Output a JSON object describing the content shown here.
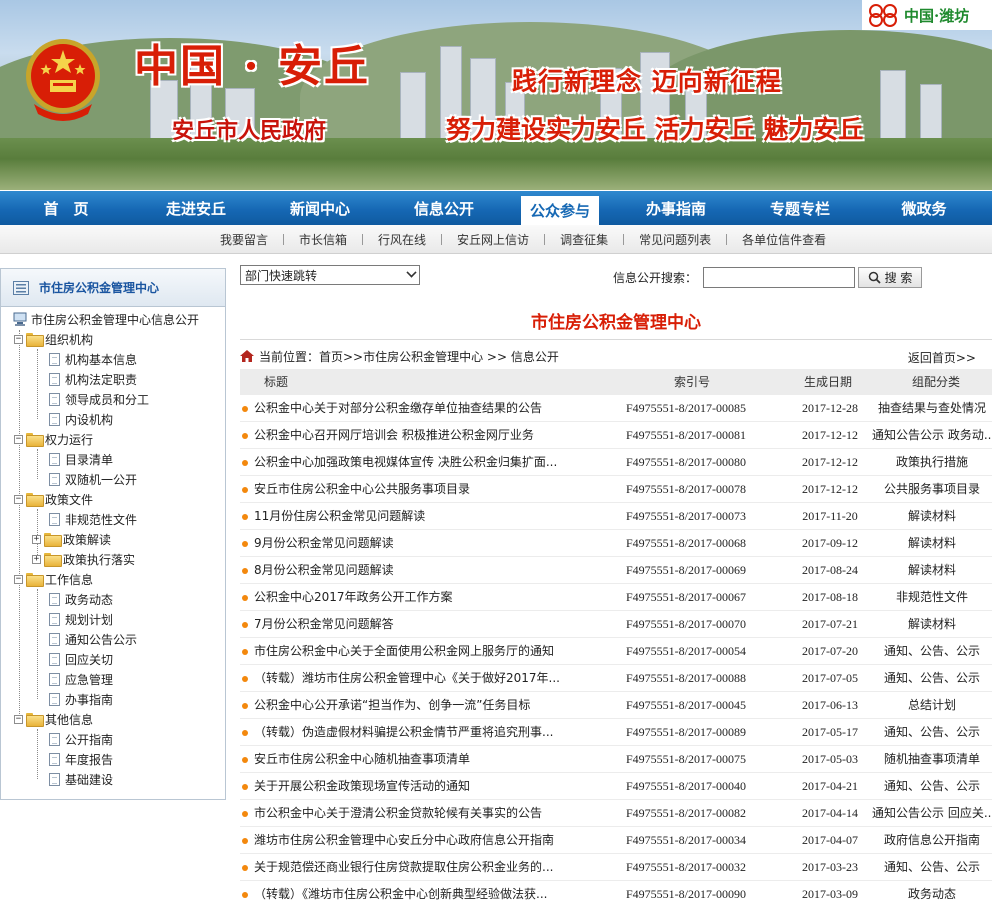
{
  "banner": {
    "site_title": "中国 · 安丘",
    "site_subtitle": "安丘市人民政府",
    "slogan_line1": "践行新理念   迈向新征程",
    "slogan_line2": "努力建设实力安丘  活力安丘  魅力安丘",
    "partner_link": "中国·潍坊"
  },
  "main_nav": {
    "items": [
      "首　页",
      "走进安丘",
      "新闻中心",
      "信息公开",
      "公众参与",
      "办事指南",
      "专题专栏",
      "微政务"
    ],
    "active": "公众参与",
    "colors": {
      "bar": "#1668b4",
      "active_bg": "#ffffff"
    }
  },
  "sub_nav": {
    "items": [
      "我要留言",
      "市长信箱",
      "行风在线",
      "安丘网上信访",
      "调查征集",
      "常见问题列表",
      "各单位信件查看"
    ]
  },
  "sidebar": {
    "title": "市住房公积金管理中心",
    "root": "市住房公积金管理中心信息公开",
    "groups": [
      {
        "label": "组织机构",
        "items": [
          "机构基本信息",
          "机构法定职责",
          "领导成员和分工",
          "内设机构"
        ]
      },
      {
        "label": "权力运行",
        "items": [
          "目录清单",
          "双随机一公开"
        ]
      },
      {
        "label": "政策文件",
        "items": [
          "非规范性文件",
          "政策解读",
          "政策执行落实"
        ]
      },
      {
        "label": "工作信息",
        "items": [
          "政务动态",
          "规划计划",
          "通知公告公示",
          "回应关切",
          "应急管理",
          "办事指南"
        ]
      },
      {
        "label": "其他信息",
        "items": [
          "公开指南",
          "年度报告",
          "基础建设"
        ]
      }
    ]
  },
  "toolbar": {
    "dept_select_value": "部门快速跳转",
    "search_label": "信息公开搜索：",
    "search_value": "",
    "search_button": "搜 索"
  },
  "content": {
    "page_title": "市住房公积金管理中心",
    "breadcrumb": "当前位置：首页>>市住房公积金管理中心 >> 信息公开",
    "back_link": "返回首页>>",
    "columns": [
      "标题",
      "索引号",
      "生成日期",
      "组配分类"
    ],
    "rows": [
      [
        "公积金中心关于对部分公积金缴存单位抽查结果的公告",
        "F4975551-8/2017-00085",
        "2017-12-28",
        "抽查结果与查处情况"
      ],
      [
        "公积金中心召开网厅培训会 积极推进公积金网厅业务",
        "F4975551-8/2017-00081",
        "2017-12-12",
        "通知公告公示 政务动..."
      ],
      [
        "公积金中心加强政策电视媒体宣传 决胜公积金归集扩面...",
        "F4975551-8/2017-00080",
        "2017-12-12",
        "政策执行措施"
      ],
      [
        "安丘市住房公积金中心公共服务事项目录",
        "F4975551-8/2017-00078",
        "2017-12-12",
        "公共服务事项目录"
      ],
      [
        "11月份住房公积金常见问题解读",
        "F4975551-8/2017-00073",
        "2017-11-20",
        "解读材料"
      ],
      [
        "9月份公积金常见问题解读",
        "F4975551-8/2017-00068",
        "2017-09-12",
        "解读材料"
      ],
      [
        "8月份公积金常见问题解读",
        "F4975551-8/2017-00069",
        "2017-08-24",
        "解读材料"
      ],
      [
        "公积金中心2017年政务公开工作方案",
        "F4975551-8/2017-00067",
        "2017-08-18",
        "非规范性文件"
      ],
      [
        "7月份公积金常见问题解答",
        "F4975551-8/2017-00070",
        "2017-07-21",
        "解读材料"
      ],
      [
        "市住房公积金中心关于全面使用公积金网上服务厅的通知",
        "F4975551-8/2017-00054",
        "2017-07-20",
        "通知、公告、公示"
      ],
      [
        "（转载）潍坊市住房公积金管理中心《关于做好2017年...",
        "F4975551-8/2017-00088",
        "2017-07-05",
        "通知、公告、公示"
      ],
      [
        "公积金中心公开承诺“担当作为、创争一流”任务目标",
        "F4975551-8/2017-00045",
        "2017-06-13",
        "总结计划"
      ],
      [
        "（转载）伪造虚假材料骗提公积金情节严重将追究刑事...",
        "F4975551-8/2017-00089",
        "2017-05-17",
        "通知、公告、公示"
      ],
      [
        "安丘市住房公积金中心随机抽查事项清单",
        "F4975551-8/2017-00075",
        "2017-05-03",
        "随机抽查事项清单"
      ],
      [
        "关于开展公积金政策现场宣传活动的通知",
        "F4975551-8/2017-00040",
        "2017-04-21",
        "通知、公告、公示"
      ],
      [
        "市公积金中心关于澄清公积金贷款轮候有关事实的公告",
        "F4975551-8/2017-00082",
        "2017-04-14",
        "通知公告公示 回应关..."
      ],
      [
        "潍坊市住房公积金管理中心安丘分中心政府信息公开指南",
        "F4975551-8/2017-00034",
        "2017-04-07",
        "政府信息公开指南"
      ],
      [
        "关于规范偿还商业银行住房贷款提取住房公积金业务的...",
        "F4975551-8/2017-00032",
        "2017-03-23",
        "通知、公告、公示"
      ],
      [
        "（转载）《潍坊市住房公积金中心创新典型经验做法获...",
        "F4975551-8/2017-00090",
        "2017-03-09",
        "政务动态"
      ]
    ]
  },
  "colors": {
    "accent_red": "#d81e06",
    "bullet_orange": "#f3880d",
    "link_blue": "#1a55a0"
  }
}
